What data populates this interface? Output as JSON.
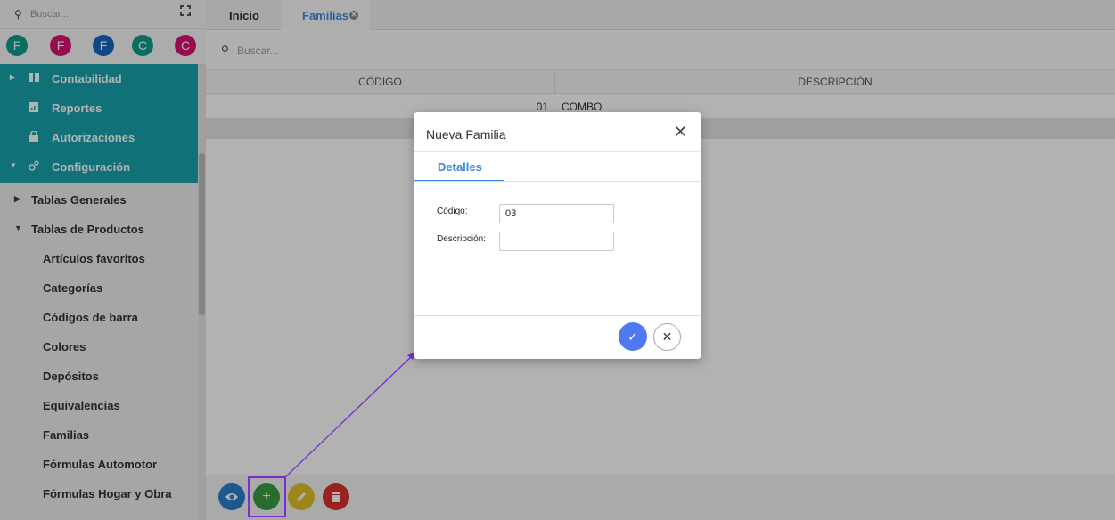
{
  "sidebar": {
    "search_placeholder": "Buscar...",
    "avatars": [
      {
        "letter": "F",
        "color": "#0f9d8c"
      },
      {
        "letter": "F",
        "color": "#d6136f"
      },
      {
        "letter": "F",
        "color": "#1565c0"
      },
      {
        "letter": "C",
        "color": "#0f9d8c"
      },
      {
        "letter": "C",
        "color": "#d6136f"
      }
    ],
    "teal_items": [
      "Contabilidad",
      "Reportes",
      "Autorizaciones",
      "Configuración"
    ],
    "groups": [
      "Tablas Generales",
      "Tablas de Productos"
    ],
    "sub_items": [
      "Artículos favoritos",
      "Categorías",
      "Códigos de barra",
      "Colores",
      "Depósitos",
      "Equivalencias",
      "Familias",
      "Fórmulas Automotor",
      "Fórmulas Hogar y Obra"
    ]
  },
  "tabs": {
    "home": "Inicio",
    "families": "Familias"
  },
  "main": {
    "search_placeholder": "Buscar...",
    "columns": {
      "code": "CÓDIGO",
      "description": "DESCRIPCIÓN"
    },
    "rows": [
      {
        "code": "01",
        "description": "COMBO"
      }
    ]
  },
  "actions": {
    "view_icon": "eye-icon",
    "add_icon": "plus-icon",
    "edit_icon": "pencil-icon",
    "delete_icon": "trash-icon",
    "colors": {
      "view": "#2a7fd0",
      "add": "#3a9d3e",
      "edit": "#e0c22a",
      "delete": "#d8322c"
    }
  },
  "modal": {
    "title": "Nueva Familia",
    "tab": "Detalles",
    "code_label": "Código:",
    "code_value": "03",
    "description_label": "Descripción:",
    "description_value": ""
  },
  "colors": {
    "teal_menu": "#17a2ad",
    "accent_blue": "#3b86dd",
    "annotation": "#7b2ec9"
  }
}
